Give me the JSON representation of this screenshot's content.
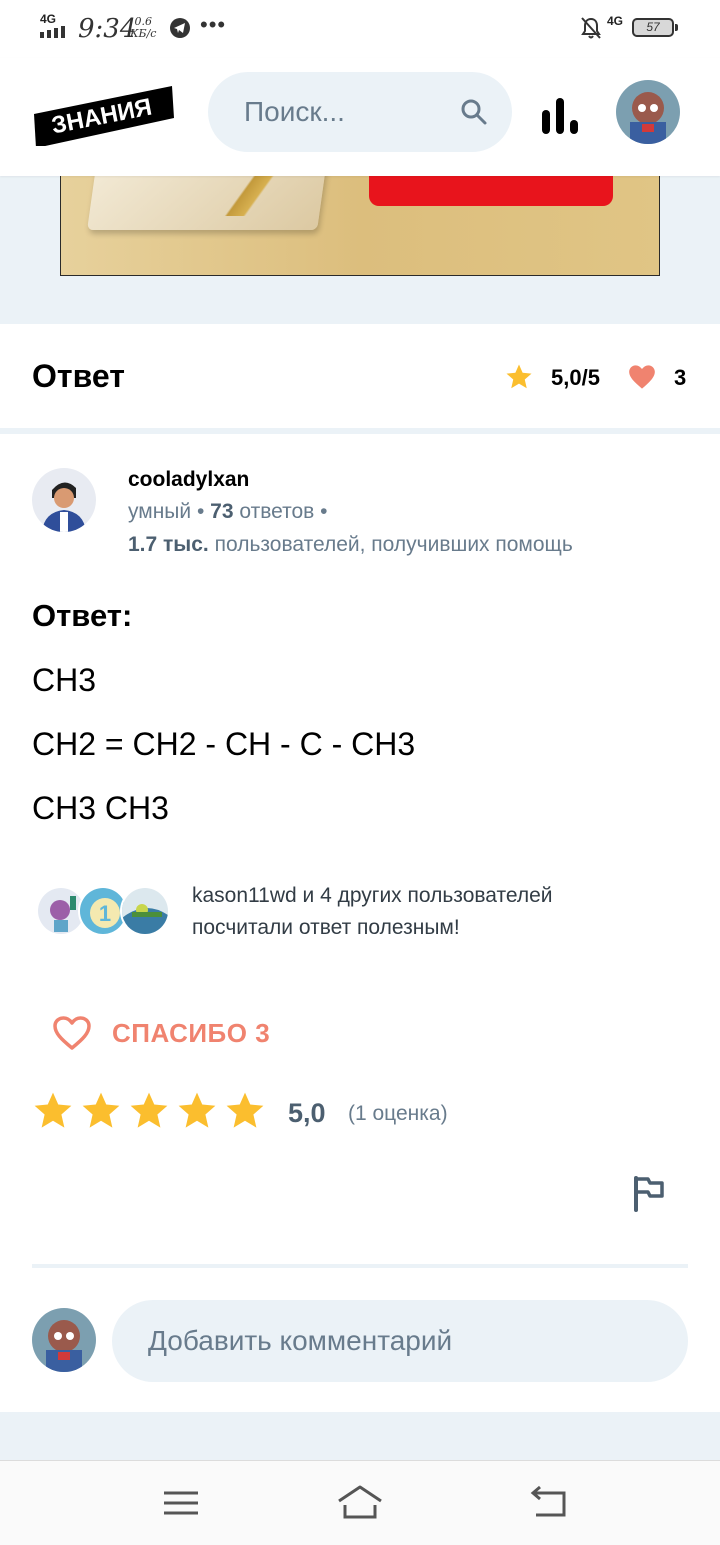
{
  "status_bar": {
    "network_left": "4G",
    "time": "9:34",
    "speed_value": "0.6",
    "speed_unit": "КБ/с",
    "dots": "•••",
    "network_right": "4G",
    "battery": "57"
  },
  "header": {
    "logo_text": "ЗНАНИЯ",
    "search_placeholder": "Поиск..."
  },
  "answer": {
    "section_title": "Ответ",
    "rating": "5,0/5",
    "thanks_count": "3",
    "author": {
      "name": "cooladylxan",
      "rank": "умный",
      "answers_count": "73",
      "answers_label": "ответов",
      "helped_count": "1.7 тыс.",
      "helped_label": "пользователей, получивших помощь"
    },
    "body_label": "Ответ:",
    "lines": [
      "CH3",
      "CH2 = CH2 - CH - C - CH3",
      "CH3 CH3"
    ],
    "helpful_text_line1": "kason11wd и 4 других пользователей",
    "helpful_text_line2": "посчитали ответ полезным!",
    "thanks_label": "СПАСИБО 3",
    "stars_value": 5,
    "rating_big": "5,0",
    "rating_count": "(1 оценка)"
  },
  "comment": {
    "placeholder": "Добавить комментарий"
  },
  "colors": {
    "accent_light": "#ebf2f7",
    "muted_text": "#687b8c",
    "star": "#fbbe2e",
    "heart": "#f0836f",
    "logo_bg": "#000000"
  }
}
